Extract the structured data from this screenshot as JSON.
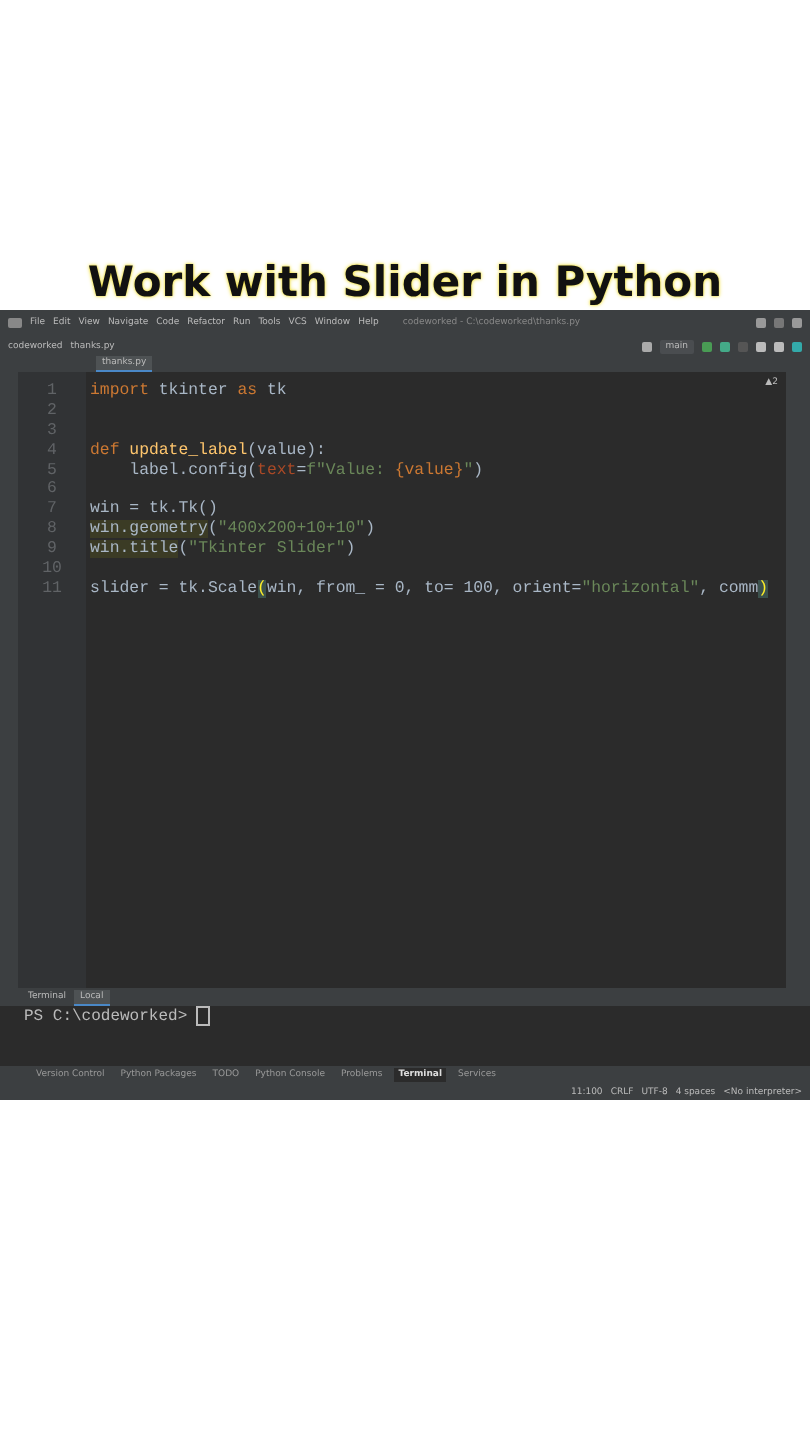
{
  "video_title": "Work with Slider in Python",
  "menu_bar": {
    "items": [
      "File",
      "Edit",
      "View",
      "Navigate",
      "Code",
      "Refactor",
      "Run",
      "Tools",
      "VCS",
      "Window",
      "Help"
    ],
    "window_title": "codeworked - C:\\codeworked\\thanks.py"
  },
  "nav_bar": {
    "breadcrumbs": [
      "codeworked",
      "thanks.py"
    ],
    "branch": "main"
  },
  "editor_tabs": [
    {
      "label": "thanks.py",
      "selected": true
    }
  ],
  "inspection": "▲2",
  "code": [
    {
      "number": "1",
      "tokens": [
        {
          "kind": "keyword",
          "text": "import"
        },
        {
          "kind": "plain",
          "text": " tkinter "
        },
        {
          "kind": "keyword",
          "text": "as"
        },
        {
          "kind": "plain",
          "text": " tk"
        }
      ]
    },
    {
      "number": "2"
    },
    {
      "number": "3"
    },
    {
      "number": "4",
      "tokens": [
        {
          "kind": "keyword",
          "text": "def "
        },
        {
          "kind": "function",
          "text": "update_label"
        },
        {
          "kind": "plain",
          "text": "(value):"
        }
      ]
    },
    {
      "number": "5",
      "tokens": [
        {
          "kind": "plain",
          "text": "    label.config("
        },
        {
          "kind": "param",
          "text": "text"
        },
        {
          "kind": "plain",
          "text": "="
        },
        {
          "kind": "string",
          "text": "f\"Value: "
        },
        {
          "kind": "interp",
          "text": "{value}"
        },
        {
          "kind": "string",
          "text": "\""
        },
        {
          "kind": "plain",
          "text": ")"
        }
      ]
    },
    {
      "number": "6"
    },
    {
      "number": "7",
      "tokens": [
        {
          "kind": "plain",
          "text": "win = tk.Tk()"
        }
      ]
    },
    {
      "number": "8",
      "tokens": [
        {
          "kind": "highlight",
          "text": "win.geometry"
        },
        {
          "kind": "plain",
          "text": "("
        },
        {
          "kind": "string",
          "text": "\"400x200+10+10\""
        },
        {
          "kind": "plain",
          "text": ")"
        }
      ]
    },
    {
      "number": "9",
      "tokens": [
        {
          "kind": "highlight",
          "text": "win.title"
        },
        {
          "kind": "plain",
          "text": "("
        },
        {
          "kind": "string",
          "text": "\"Tkinter Slider\""
        },
        {
          "kind": "plain",
          "text": ")"
        }
      ]
    },
    {
      "number": "10"
    },
    {
      "number": "11",
      "tokens": [
        {
          "kind": "plain",
          "text": "slider = tk.Scale"
        },
        {
          "kind": "brace",
          "text": "("
        },
        {
          "kind": "plain",
          "text": "win, from_ = 0, to= 100, orient="
        },
        {
          "kind": "string",
          "text": "\"horizontal\""
        },
        {
          "kind": "plain",
          "text": ", comm"
        },
        {
          "kind": "brace",
          "text": ")"
        }
      ]
    }
  ],
  "terminal": {
    "title": "Terminal",
    "tabs": [
      {
        "label": "Local",
        "selected": true
      }
    ],
    "prompt": "PS C:\\codeworked> "
  },
  "tool_tabs": [
    {
      "label": "Version Control",
      "selected": false
    },
    {
      "label": "Python Packages",
      "selected": false
    },
    {
      "label": "TODO",
      "selected": false
    },
    {
      "label": "Python Console",
      "selected": false
    },
    {
      "label": "Problems",
      "selected": false
    },
    {
      "label": "Terminal",
      "selected": true
    },
    {
      "label": "Services",
      "selected": false
    }
  ],
  "status_bar": [
    "11:100",
    "CRLF",
    "UTF-8",
    "4 spaces",
    "<No interpreter>"
  ]
}
